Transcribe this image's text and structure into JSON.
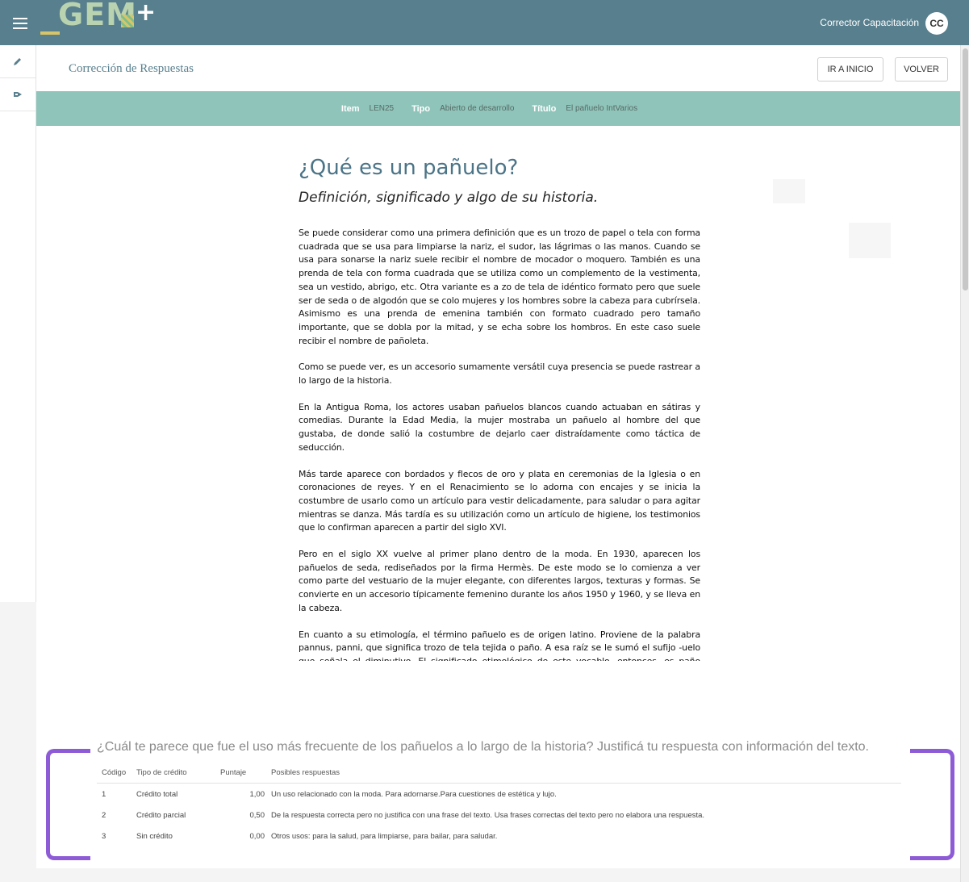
{
  "topbar": {
    "logo_text": "GEM",
    "logo_plus": "+",
    "user_name": "Corrector Capacitación",
    "avatar_initials": "CC"
  },
  "rail": {
    "icons": [
      "pencil-icon",
      "sign-out-icon"
    ]
  },
  "header": {
    "title": "Corrección de Respuestas",
    "home_button": "IR A INICIO",
    "back_button": "VOLVER"
  },
  "item_info": {
    "item_label": "Item",
    "item_value": "LEN25",
    "tipo_label": "Tipo",
    "tipo_value": "Abierto de desarrollo",
    "titulo_label": "Título",
    "titulo_value": "El pañuelo IntVarios"
  },
  "document": {
    "title": "¿Qué es un pañuelo?",
    "subtitle": "Definición, significado y algo de su historia.",
    "paragraphs": [
      "Se puede considerar como una primera definición que es un trozo de papel o tela con forma cuadrada que se usa para limpiarse la nariz, el sudor, las lágrimas o las manos. Cuando se usa para sonarse la nariz suele recibir el nombre de mocador o moquero. También es una prenda de tela con forma cuadrada que se utiliza como un complemento de la vestimenta, sea un vestido, abrigo, etc. Otra variante es a      zo de tela de idéntico formato pero que suele ser de seda o de algodón que se colo         mujeres y los hombres sobre la cabeza para cubrírsela. Asimismo es una prenda de           emenina también con formato cuadrado pero tamaño importante, que se dobla por la mitad, y se echa sobre los hombros. En este caso suele recibir el nombre de pañoleta.",
      "Como se puede ver, es un accesorio sumamente versátil cuya presencia se puede rastrear a lo largo de la historia.",
      "En la Antigua Roma, los actores usaban pañuelos blancos cuando actuaban en sátiras y comedias. Durante la Edad Media, la mujer mostraba un pañuelo al hombre del que gustaba, de donde salió la costumbre de dejarlo caer distraídamente como táctica de seducción.",
      "Más tarde aparece con bordados y flecos de oro y plata en ceremonias de la Iglesia o en coronaciones de reyes. Y en el Renacimiento se lo adorna con encajes y se inicia la costumbre de usarlo como un artículo para vestir delicadamente, para saludar o para agitar mientras se danza. Más tardía es su utilización como un artículo de higiene, los testimonios que lo confirman aparecen a partir del siglo XVI.",
      "Pero en el siglo XX vuelve al primer plano dentro de la moda. En 1930, aparecen los pañuelos de seda, rediseñados por la firma Hermès. De este modo se lo comienza a ver como parte del vestuario de la mujer elegante, con diferentes largos, texturas y formas. Se convierte en un accesorio típicamente femenino durante los años 1950 y 1960, y se lleva en la cabeza.",
      "En cuanto a su etimología, el término pañuelo es de origen latino. Proviene de la palabra pannus, panni, que significa trozo de tela tejida o paño. A esa raíz se le sumó el sufijo -uelo que señala el diminutivo. El significado etimológico de este vocablo, entonces, es paño pequeño, pañito."
    ]
  },
  "question": {
    "text": "¿Cuál te parece que  fue el uso más frecuente de los pañuelos a lo largo de la historia? Justificá tu respuesta con información del texto."
  },
  "criteria": {
    "headers": [
      "Código",
      "Tipo de crédito",
      "Puntaje",
      "Posibles respuestas"
    ],
    "rows": [
      [
        "1",
        "Crédito total",
        "1,00",
        "Un uso relacionado con la moda. Para adornarse.Para cuestiones de estética y lujo."
      ],
      [
        "2",
        "Crédito parcial",
        "0,50",
        "De la respuesta correcta pero no justifica con una frase del texto. Usa frases correctas del texto pero no elabora una respuesta."
      ],
      [
        "3",
        "Sin crédito",
        "0,00",
        "Otros usos: para la salud, para limpiarse, para bailar, para saludar."
      ]
    ]
  },
  "colors": {
    "topbar": "#587f8d",
    "strip": "#8fc4ba",
    "bracket": "#8e5bd6",
    "title": "#4b7487"
  }
}
